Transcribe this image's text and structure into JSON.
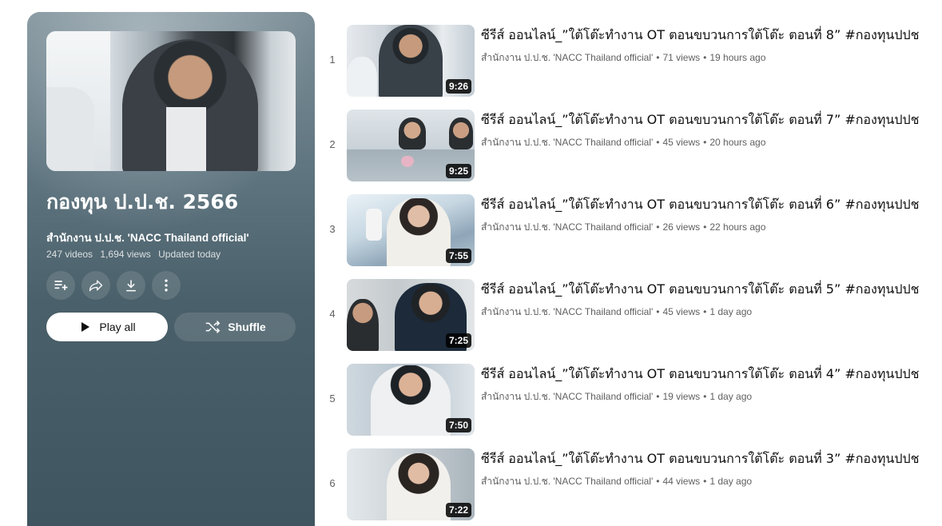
{
  "playlist": {
    "title": "กองทุน ป.ป.ช. 2566",
    "owner": "สำนักงาน ป.ป.ช. 'NACC Thailand official'",
    "video_count": "247 videos",
    "views": "1,694 views",
    "updated": "Updated today",
    "actions": [
      {
        "icon": "add-to-queue-icon"
      },
      {
        "icon": "share-icon"
      },
      {
        "icon": "download-icon"
      },
      {
        "icon": "more-vert-icon"
      }
    ],
    "play_all_label": "Play all",
    "shuffle_label": "Shuffle"
  },
  "videos": [
    {
      "index": "1",
      "title": "ซีรีส์ ออนไลน์_”ใต้โต๊ะทำงาน OT ตอนขบวนการใต้โต๊ะ ตอนที่ 8” #กองทุนปปช",
      "channel": "สำนักงาน ป.ป.ช. 'NACC Thailand official'",
      "views": "71 views",
      "age": "19 hours ago",
      "duration": "9:26"
    },
    {
      "index": "2",
      "title": "ซีรีส์ ออนไลน์_”ใต้โต๊ะทำงาน OT ตอนขบวนการใต้โต๊ะ ตอนที่ 7” #กองทุนปปช",
      "channel": "สำนักงาน ป.ป.ช. 'NACC Thailand official'",
      "views": "45 views",
      "age": "20 hours ago",
      "duration": "9:25"
    },
    {
      "index": "3",
      "title": "ซีรีส์ ออนไลน์_”ใต้โต๊ะทำงาน OT ตอนขบวนการใต้โต๊ะ ตอนที่ 6” #กองทุนปปช",
      "channel": "สำนักงาน ป.ป.ช. 'NACC Thailand official'",
      "views": "26 views",
      "age": "22 hours ago",
      "duration": "7:55"
    },
    {
      "index": "4",
      "title": "ซีรีส์ ออนไลน์_”ใต้โต๊ะทำงาน OT ตอนขบวนการใต้โต๊ะ ตอนที่ 5” #กองทุนปปช",
      "channel": "สำนักงาน ป.ป.ช. 'NACC Thailand official'",
      "views": "45 views",
      "age": "1 day ago",
      "duration": "7:25"
    },
    {
      "index": "5",
      "title": "ซีรีส์ ออนไลน์_”ใต้โต๊ะทำงาน OT ตอนขบวนการใต้โต๊ะ ตอนที่ 4” #กองทุนปปช",
      "channel": "สำนักงาน ป.ป.ช. 'NACC Thailand official'",
      "views": "19 views",
      "age": "1 day ago",
      "duration": "7:50"
    },
    {
      "index": "6",
      "title": "ซีรีส์ ออนไลน์_”ใต้โต๊ะทำงาน OT ตอนขบวนการใต้โต๊ะ ตอนที่ 3” #กองทุนปปช",
      "channel": "สำนักงาน ป.ป.ช. 'NACC Thailand official'",
      "views": "44 views",
      "age": "1 day ago",
      "duration": "7:22"
    }
  ]
}
